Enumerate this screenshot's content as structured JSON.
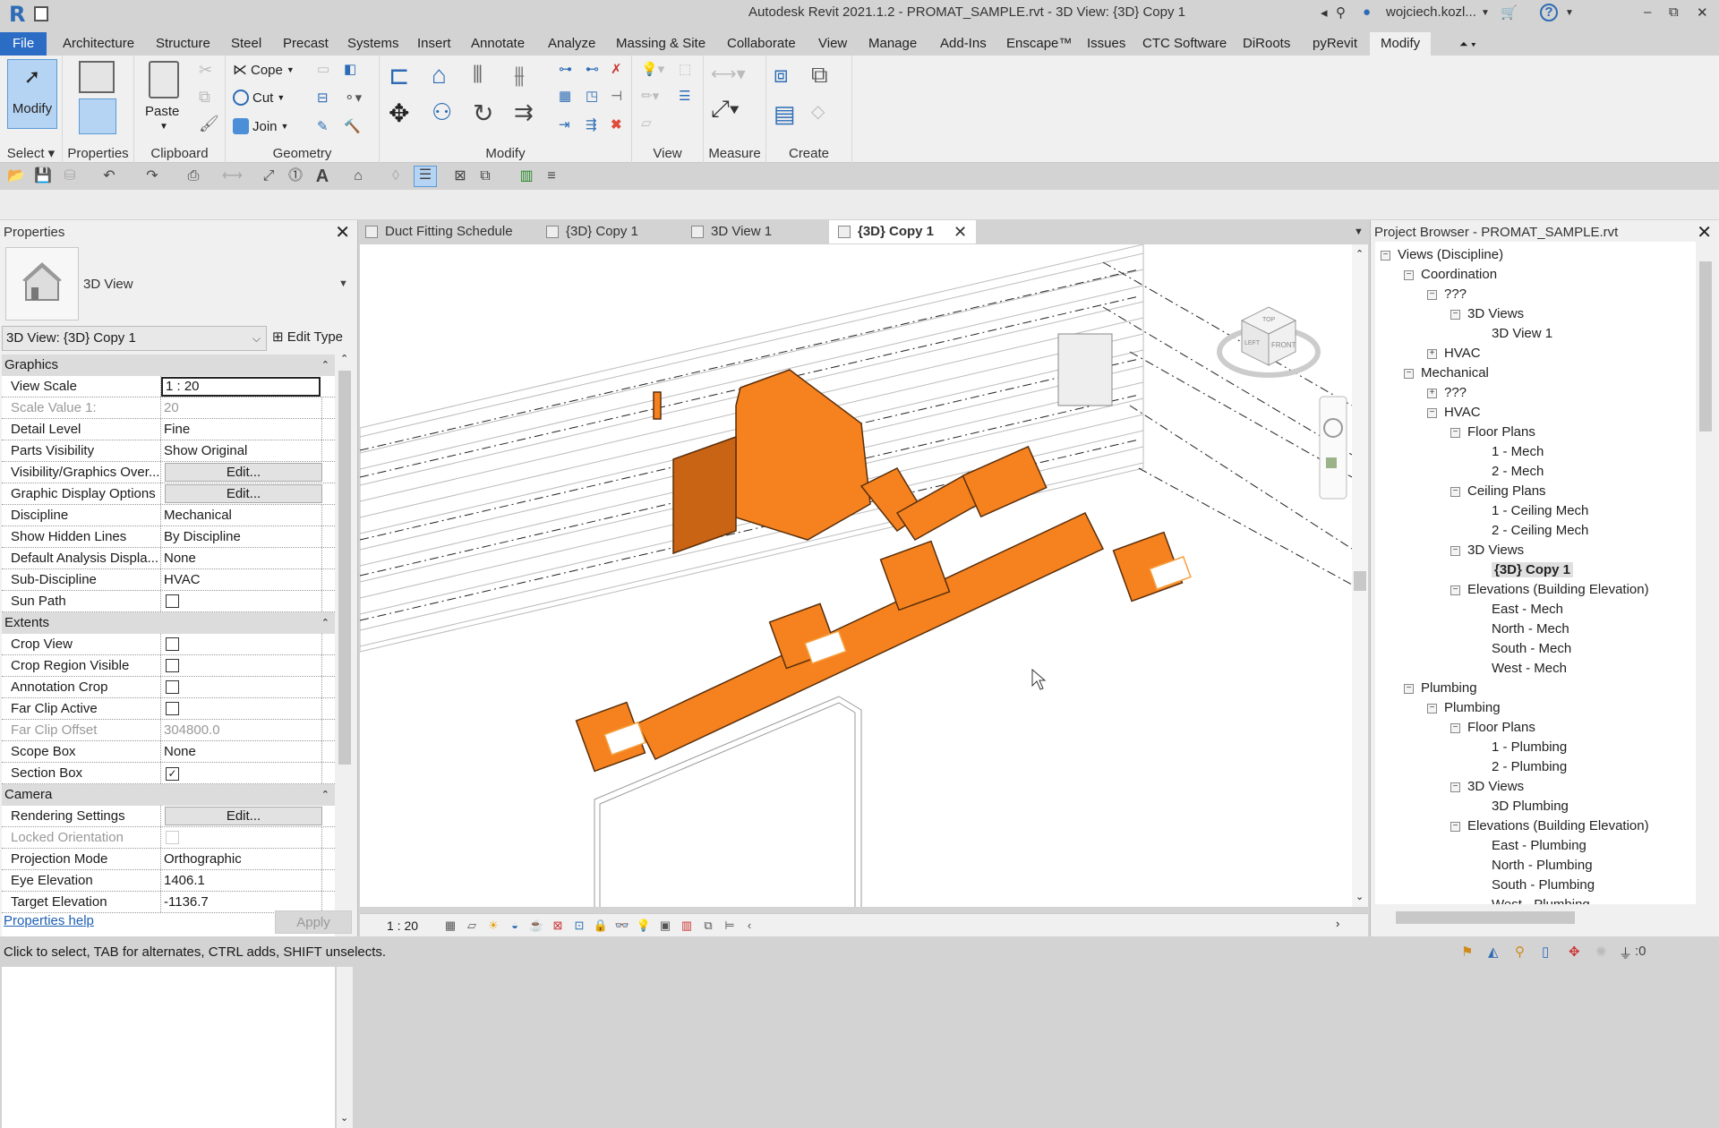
{
  "window": {
    "title": "Autodesk Revit 2021.1.2 - PROMAT_SAMPLE.rvt - 3D View: {3D} Copy 1",
    "user": "wojciech.kozl...",
    "controls": {
      "minimize": "–",
      "restore": "⧉",
      "close": "✕"
    }
  },
  "menu_tabs": [
    "File",
    "Architecture",
    "Structure",
    "Steel",
    "Precast",
    "Systems",
    "Insert",
    "Annotate",
    "Analyze",
    "Massing & Site",
    "Collaborate",
    "View",
    "Manage",
    "Add-Ins",
    "Enscape™",
    "Issues",
    "CTC Software",
    "DiRoots",
    "pyRevit",
    "Modify"
  ],
  "active_menu_tab": "Modify",
  "ribbon": {
    "select": {
      "button": "Modify",
      "label": "Select ▾"
    },
    "properties": {
      "label": "Properties"
    },
    "clipboard": {
      "paste": "Paste",
      "label": "Clipboard"
    },
    "geometry": {
      "cope": "Cope",
      "cut": "Cut",
      "join": "Join",
      "label": "Geometry"
    },
    "modify": {
      "label": "Modify"
    },
    "view": {
      "label": "View"
    },
    "measure": {
      "label": "Measure"
    },
    "create": {
      "label": "Create"
    }
  },
  "properties_panel": {
    "title": "Properties",
    "type_name": "3D View",
    "view_selector": "3D View: {3D} Copy 1",
    "edit_type": "Edit Type",
    "sections": [
      {
        "name": "Graphics",
        "rows": [
          {
            "k": "View Scale",
            "v": "1 : 20",
            "kind": "input"
          },
          {
            "k": "Scale Value    1:",
            "v": "20",
            "kind": "disabled"
          },
          {
            "k": "Detail Level",
            "v": "Fine"
          },
          {
            "k": "Parts Visibility",
            "v": "Show Original"
          },
          {
            "k": "Visibility/Graphics Over...",
            "v": "Edit...",
            "kind": "button"
          },
          {
            "k": "Graphic Display Options",
            "v": "Edit...",
            "kind": "button"
          },
          {
            "k": "Discipline",
            "v": "Mechanical"
          },
          {
            "k": "Show Hidden Lines",
            "v": "By Discipline"
          },
          {
            "k": "Default Analysis Displa...",
            "v": "None"
          },
          {
            "k": "Sub-Discipline",
            "v": "HVAC"
          },
          {
            "k": "Sun Path",
            "v": false,
            "kind": "checkbox"
          }
        ]
      },
      {
        "name": "Extents",
        "rows": [
          {
            "k": "Crop View",
            "v": false,
            "kind": "checkbox"
          },
          {
            "k": "Crop Region Visible",
            "v": false,
            "kind": "checkbox"
          },
          {
            "k": "Annotation Crop",
            "v": false,
            "kind": "checkbox"
          },
          {
            "k": "Far Clip Active",
            "v": false,
            "kind": "checkbox"
          },
          {
            "k": "Far Clip Offset",
            "v": "304800.0",
            "kind": "disabled"
          },
          {
            "k": "Scope Box",
            "v": "None"
          },
          {
            "k": "Section Box",
            "v": true,
            "kind": "checkbox"
          }
        ]
      },
      {
        "name": "Camera",
        "rows": [
          {
            "k": "Rendering Settings",
            "v": "Edit...",
            "kind": "button"
          },
          {
            "k": "Locked Orientation",
            "v": false,
            "kind": "checkbox-disabled"
          },
          {
            "k": "Projection Mode",
            "v": "Orthographic"
          },
          {
            "k": "Eye Elevation",
            "v": "1406.1"
          },
          {
            "k": "Target Elevation",
            "v": "-1136.7"
          }
        ]
      }
    ],
    "help_link": "Properties help",
    "apply": "Apply"
  },
  "doc_tabs": [
    {
      "label": "Duct Fitting Schedule",
      "icon": "schedule-icon"
    },
    {
      "label": "{3D} Copy 1",
      "icon": "3d-view-icon"
    },
    {
      "label": "3D View 1",
      "icon": "3d-view-icon"
    },
    {
      "label": "{3D} Copy 1",
      "icon": "3d-view-icon",
      "active": true
    }
  ],
  "viewport": {
    "scale": "1 : 20",
    "viewcube": {
      "top": "TOP",
      "left": "LEFT",
      "front": "FRONT"
    },
    "duct_color": "#f5821f"
  },
  "project_browser": {
    "title": "Project Browser - PROMAT_SAMPLE.rvt",
    "nodes": [
      {
        "label": "Views (Discipline)",
        "depth": 0,
        "toggle": "-"
      },
      {
        "label": "Coordination",
        "depth": 1,
        "toggle": "-"
      },
      {
        "label": "???",
        "depth": 2,
        "toggle": "-"
      },
      {
        "label": "3D Views",
        "depth": 3,
        "toggle": "-"
      },
      {
        "label": "3D View 1",
        "depth": 4
      },
      {
        "label": "HVAC",
        "depth": 2,
        "toggle": "+"
      },
      {
        "label": "Mechanical",
        "depth": 1,
        "toggle": "-"
      },
      {
        "label": "???",
        "depth": 2,
        "toggle": "+"
      },
      {
        "label": "HVAC",
        "depth": 2,
        "toggle": "-"
      },
      {
        "label": "Floor Plans",
        "depth": 3,
        "toggle": "-"
      },
      {
        "label": "1 - Mech",
        "depth": 4
      },
      {
        "label": "2 - Mech",
        "depth": 4
      },
      {
        "label": "Ceiling Plans",
        "depth": 3,
        "toggle": "-"
      },
      {
        "label": "1 - Ceiling Mech",
        "depth": 4
      },
      {
        "label": "2 - Ceiling Mech",
        "depth": 4
      },
      {
        "label": "3D Views",
        "depth": 3,
        "toggle": "-"
      },
      {
        "label": "{3D} Copy 1",
        "depth": 4,
        "selected": true
      },
      {
        "label": "Elevations (Building Elevation)",
        "depth": 3,
        "toggle": "-"
      },
      {
        "label": "East - Mech",
        "depth": 4
      },
      {
        "label": "North - Mech",
        "depth": 4
      },
      {
        "label": "South - Mech",
        "depth": 4
      },
      {
        "label": "West - Mech",
        "depth": 4
      },
      {
        "label": "Plumbing",
        "depth": 1,
        "toggle": "-"
      },
      {
        "label": "Plumbing",
        "depth": 2,
        "toggle": "-"
      },
      {
        "label": "Floor Plans",
        "depth": 3,
        "toggle": "-"
      },
      {
        "label": "1 - Plumbing",
        "depth": 4
      },
      {
        "label": "2 - Plumbing",
        "depth": 4
      },
      {
        "label": "3D Views",
        "depth": 3,
        "toggle": "-"
      },
      {
        "label": "3D Plumbing",
        "depth": 4
      },
      {
        "label": "Elevations (Building Elevation)",
        "depth": 3,
        "toggle": "-"
      },
      {
        "label": "East - Plumbing",
        "depth": 4
      },
      {
        "label": "North - Plumbing",
        "depth": 4
      },
      {
        "label": "South - Plumbing",
        "depth": 4
      },
      {
        "label": "West - Plumbing",
        "depth": 4
      }
    ]
  },
  "status_bar": {
    "message": "Click to select, TAB for alternates, CTRL adds, SHIFT unselects.",
    "filter_count": ":0"
  }
}
